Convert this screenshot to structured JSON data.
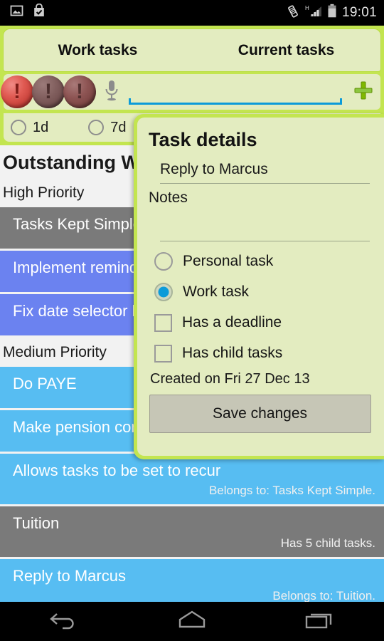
{
  "statusbar": {
    "time": "19:01",
    "left_icons": [
      "image-icon",
      "shopping-bag-check-icon"
    ],
    "right_icons": [
      "vibrate-icon",
      "signal-h-icon",
      "battery-icon"
    ],
    "network_type": "H"
  },
  "tabs": [
    {
      "label": "Work tasks",
      "name": "tab-work-tasks",
      "selected": true
    },
    {
      "label": "Current tasks",
      "name": "tab-current-tasks",
      "selected": false
    }
  ],
  "toolbar": {
    "priority_balls": [
      {
        "name": "priority-high-button",
        "level": "high",
        "glyph": "!",
        "selected": true
      },
      {
        "name": "priority-medium-button",
        "level": "medium",
        "glyph": "!",
        "selected": false
      },
      {
        "name": "priority-low-button",
        "level": "low",
        "glyph": "!",
        "selected": false
      }
    ],
    "mic_icon": "microphone-icon",
    "new_task_value": "",
    "new_task_placeholder": "",
    "add_icon": "plus-icon"
  },
  "recurrence": {
    "options": [
      {
        "label": "1d",
        "checked": false
      },
      {
        "label": "7d",
        "checked": false
      }
    ]
  },
  "list": {
    "title": "Outstanding Work tasks",
    "sections": [
      {
        "heading": "High Priority",
        "rows": [
          {
            "title": "Tasks Kept Simple",
            "sub": "",
            "color": "gray"
          },
          {
            "title": "Implement reminder alarms",
            "sub": "",
            "color": "blue"
          },
          {
            "title": "Fix date selector bug",
            "sub": "",
            "color": "blue"
          }
        ]
      },
      {
        "heading": "Medium Priority",
        "rows": [
          {
            "title": "Do PAYE",
            "sub": "",
            "color": "cyan"
          },
          {
            "title": "Make pension contribution",
            "sub": "",
            "color": "cyan"
          },
          {
            "title": "Allows tasks to be set to recur",
            "sub": "Belongs to: Tasks Kept Simple.",
            "color": "cyan"
          },
          {
            "title": "Tuition",
            "sub": "Has 5 child tasks.",
            "color": "gray"
          },
          {
            "title": "Reply to Marcus",
            "sub": "Belongs to: Tuition.",
            "color": "cyan"
          }
        ]
      }
    ]
  },
  "dialog": {
    "title": "Task details",
    "task_name_value": "Reply to Marcus",
    "notes_label": "Notes",
    "notes_value": "",
    "options": [
      {
        "label": "Personal task",
        "type": "radio",
        "checked": false,
        "name": "personal-task-radio"
      },
      {
        "label": "Work task",
        "type": "radio",
        "checked": true,
        "name": "work-task-radio"
      },
      {
        "label": "Has a deadline",
        "type": "checkbox",
        "checked": false,
        "name": "has-deadline-checkbox"
      },
      {
        "label": "Has child tasks",
        "type": "checkbox",
        "checked": false,
        "name": "has-child-tasks-checkbox"
      }
    ],
    "created_text": "Created on Fri 27 Dec 13",
    "save_label": "Save changes"
  },
  "navbar": {
    "back_icon": "back-arrow-icon",
    "home_icon": "home-icon",
    "recents_icon": "recent-apps-icon"
  },
  "colors": {
    "accent_green": "#c3e550",
    "panel_green": "#e3ecc0",
    "row_blue": "#6b82f0",
    "row_cyan": "#57bdf2",
    "row_gray": "#7a7a7a",
    "underline_blue": "#0c9bd9"
  }
}
